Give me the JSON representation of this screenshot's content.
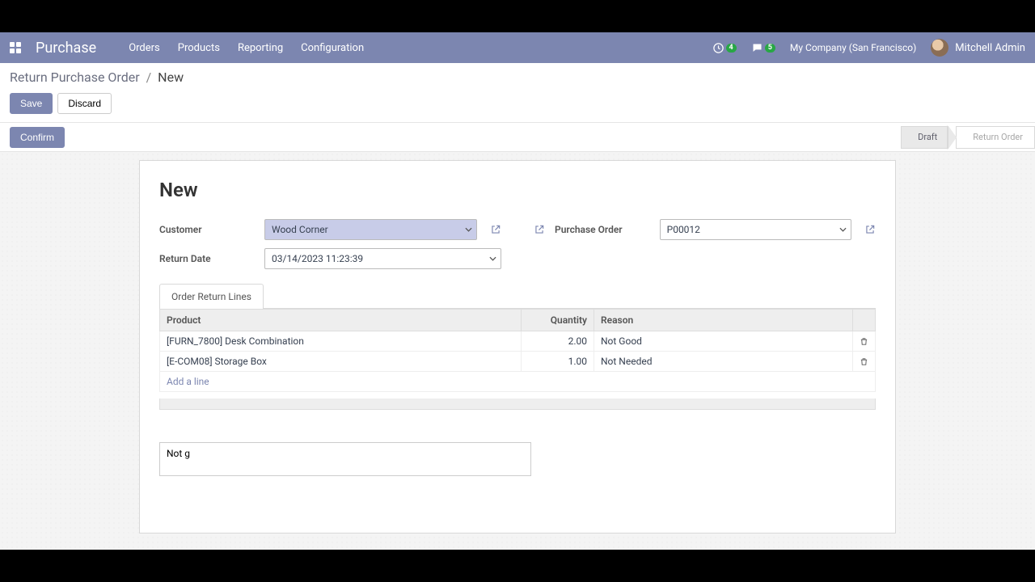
{
  "nav": {
    "brand": "Purchase",
    "items": [
      "Orders",
      "Products",
      "Reporting",
      "Configuration"
    ],
    "activity_badge": "4",
    "discuss_badge": "5",
    "company": "My Company (San Francisco)",
    "user": "Mitchell Admin"
  },
  "breadcrumb": {
    "parent": "Return Purchase Order",
    "current": "New"
  },
  "buttons": {
    "save": "Save",
    "discard": "Discard",
    "confirm": "Confirm"
  },
  "status": {
    "draft": "Draft",
    "return_order": "Return Order"
  },
  "sheet": {
    "title": "New",
    "customer_label": "Customer",
    "customer_value": "Wood Corner",
    "return_date_label": "Return Date",
    "return_date_value": "03/14/2023 11:23:39",
    "po_label": "Purchase Order",
    "po_value": "P00012",
    "tab_label": "Order Return Lines",
    "columns": {
      "product": "Product",
      "qty": "Quantity",
      "reason": "Reason"
    },
    "rows": [
      {
        "product": "[FURN_7800] Desk Combination",
        "qty": "2.00",
        "reason": "Not Good"
      },
      {
        "product": "[E-COM08] Storage Box",
        "qty": "1.00",
        "reason": "Not Needed"
      }
    ],
    "add_line": "Add a line",
    "notes_value": "Not g"
  }
}
